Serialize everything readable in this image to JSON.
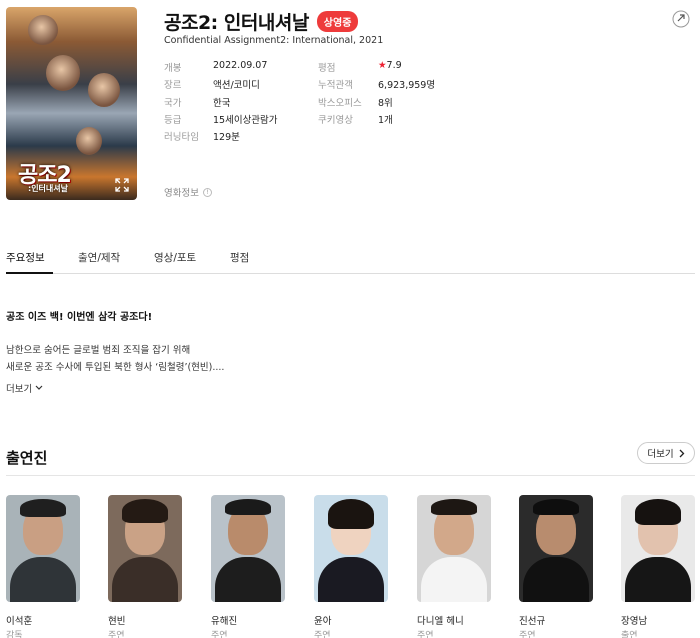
{
  "movie": {
    "title": "공조2: 인터내셔날",
    "status_badge": "상영중",
    "original_title": "Confidential Assignment2: International, 2021",
    "poster_title": "공조2",
    "poster_subtitle": ":인터내셔날"
  },
  "details_left": [
    {
      "label": "개봉",
      "value": "2022.09.07"
    },
    {
      "label": "장르",
      "value": "액션/코미디"
    },
    {
      "label": "국가",
      "value": "한국"
    },
    {
      "label": "등급",
      "value": "15세이상관람가"
    },
    {
      "label": "러닝타임",
      "value": "129분"
    }
  ],
  "details_right": [
    {
      "label": "평점",
      "value": "7.9"
    },
    {
      "label": "누적관객",
      "value": "6,923,959명"
    },
    {
      "label": "박스오피스",
      "value": "8위"
    },
    {
      "label": "쿠키영상",
      "value": "1개"
    }
  ],
  "movie_info_link": "영화정보",
  "tabs": [
    {
      "label": "주요정보",
      "active": true
    },
    {
      "label": "출연/제작",
      "active": false
    },
    {
      "label": "영상/포토",
      "active": false
    },
    {
      "label": "평점",
      "active": false
    }
  ],
  "synopsis": {
    "headline": "공조 이즈 백! 이번엔 삼각 공조다!",
    "line1": "남한으로 숨어든 글로벌 범죄 조직을 잡기 위해",
    "line2": "새로운 공조 수사에 투입된 북한 형사 ‘림철령’(현빈)....",
    "more_label": "더보기"
  },
  "cast": {
    "heading": "출연진",
    "more_label": "더보기",
    "members": [
      {
        "name": "이석훈",
        "role": "감독"
      },
      {
        "name": "현빈",
        "role": "주연"
      },
      {
        "name": "유해진",
        "role": "주연"
      },
      {
        "name": "윤아",
        "role": "주연"
      },
      {
        "name": "다니엘 헤니",
        "role": "주연"
      },
      {
        "name": "진선규",
        "role": "주연"
      },
      {
        "name": "장영남",
        "role": "출연"
      }
    ]
  },
  "colors": {
    "badge": "#ee3b3b",
    "star": "#ee2233"
  }
}
